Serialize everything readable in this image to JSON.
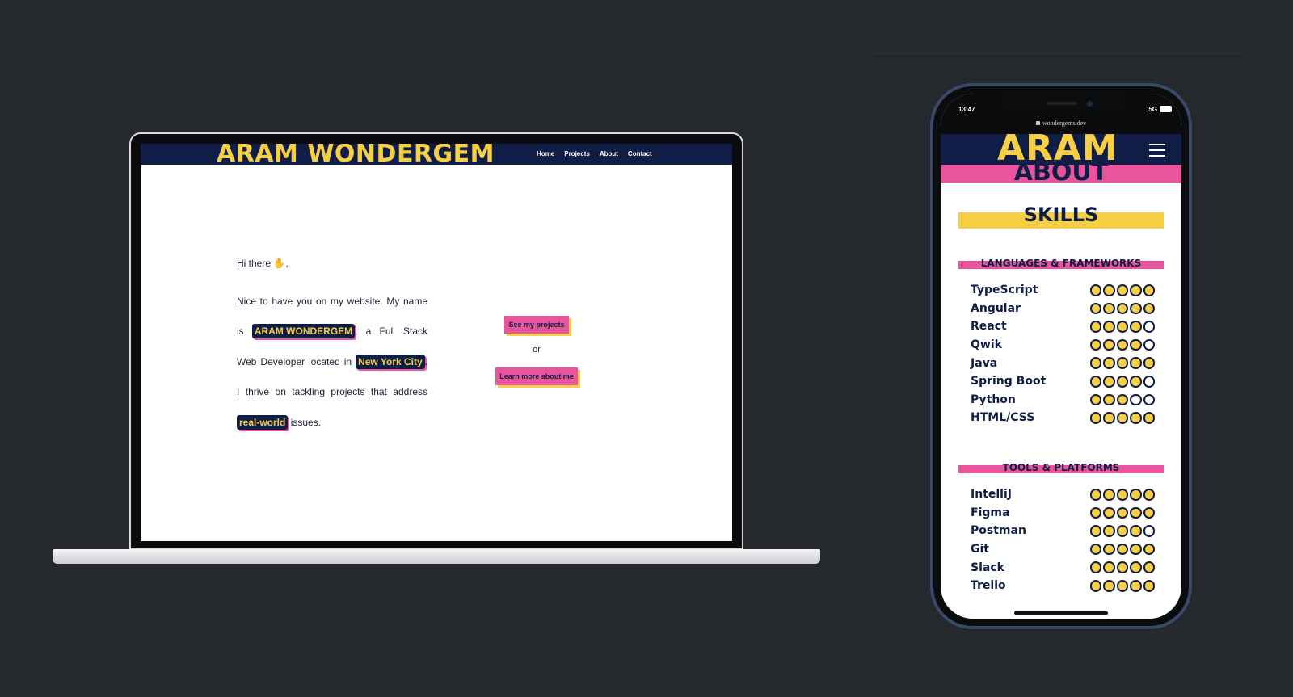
{
  "laptop": {
    "header": {
      "logo": "ARAM WONDERGEM",
      "nav": [
        "Home",
        "Projects",
        "About",
        "Contact"
      ]
    },
    "intro": {
      "greeting": "Hi there",
      "greeting_end": ",",
      "hand_icon": "waving-hand-icon",
      "text_1": "Nice to have you on my website. My name is ",
      "highlight_name": "ARAM WONDERGEM",
      "text_2": ", a Full Stack Web Developer located in ",
      "highlight_location": "New York City",
      "text_3": ". I thrive on tackling projects that address ",
      "highlight_realworld": "real-world",
      "text_4": " issues."
    },
    "cta": {
      "projects_button": "See my projects",
      "or": "or",
      "about_button": "Learn more about me"
    }
  },
  "phone": {
    "status": {
      "time": "13:47",
      "signal": "5G"
    },
    "url": "wondergems.dev",
    "header": {
      "logo": "ARAM",
      "page": "ABOUT"
    },
    "skills_title": "SKILLS",
    "sections": [
      {
        "title": "LANGUAGES & FRAMEWORKS",
        "items": [
          {
            "name": "TypeScript",
            "level": 5
          },
          {
            "name": "Angular",
            "level": 5
          },
          {
            "name": "React",
            "level": 4
          },
          {
            "name": "Qwik",
            "level": 4
          },
          {
            "name": "Java",
            "level": 5
          },
          {
            "name": "Spring Boot",
            "level": 4
          },
          {
            "name": "Python",
            "level": 3
          },
          {
            "name": "HTML/CSS",
            "level": 5
          }
        ]
      },
      {
        "title": "TOOLS & PLATFORMS",
        "items": [
          {
            "name": "IntelliJ",
            "level": 5
          },
          {
            "name": "Figma",
            "level": 5
          },
          {
            "name": "Postman",
            "level": 4
          },
          {
            "name": "Git",
            "level": 5
          },
          {
            "name": "Slack",
            "level": 5
          },
          {
            "name": "Trello",
            "level": 5
          }
        ]
      }
    ],
    "max_level": 5
  },
  "colors": {
    "navy": "#0f1d47",
    "yellow": "#f6cf44",
    "pink": "#e9559c",
    "background": "#25282c"
  }
}
